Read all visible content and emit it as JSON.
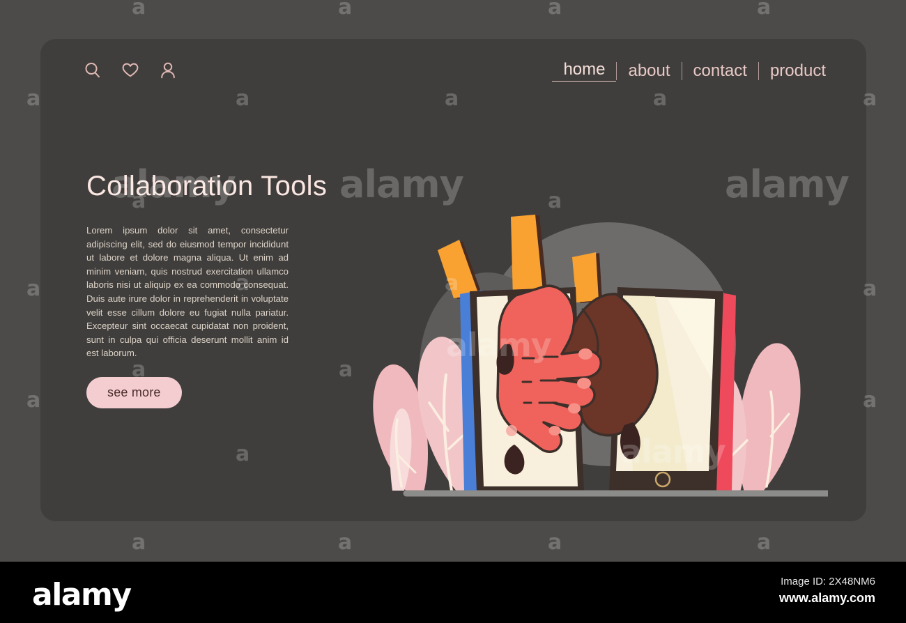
{
  "page": {
    "background_color": "#4c4b49",
    "card_color": "#403e3c"
  },
  "header": {
    "icons": [
      {
        "name": "search-icon",
        "label": "search"
      },
      {
        "name": "heart-icon",
        "label": "favorites"
      },
      {
        "name": "user-icon",
        "label": "account"
      }
    ],
    "nav": [
      {
        "label": "home",
        "active": true
      },
      {
        "label": "about",
        "active": false
      },
      {
        "label": "contact",
        "active": false
      },
      {
        "label": "product",
        "active": false
      }
    ],
    "separator": "|"
  },
  "hero": {
    "headline": "Collaboration Tools",
    "body": "Lorem ipsum dolor sit amet, consectetur adipiscing elit, sed do eiusmod tempor incididunt ut labore et dolore magna aliqua. Ut enim ad minim veniam, quis nostrud exercitation ullamco laboris nisi ut aliquip ex ea commodo consequat. Duis aute irure dolor in reprehenderit in voluptate velit esse cillum dolore eu fugiat nulla pariatur. Excepteur sint occaecat cupidatat non proident, sunt in culpa qui officia deserunt mollit anim id est laborum.",
    "cta_label": "see more"
  },
  "illustration": {
    "description": "two smartphones with hands shaking between their screens, orange rays above, pink leaves behind",
    "colors": {
      "phone_left_edge": "#4a7fd8",
      "phone_right_edge": "#ef4a5c",
      "phone_frame": "#3d2f2a",
      "screen_cream": "#f8f0dc",
      "hand_light": "#f0635c",
      "hand_dark": "#6b3528",
      "ray_orange": "#f9a232",
      "leaf_pink": "#f2c6c8",
      "blob_gray": "#6e6c6a",
      "ground_line": "#8c8c8a"
    }
  },
  "watermark": {
    "letter": "a",
    "word": "alamy"
  },
  "footer": {
    "logo": "alamy",
    "image_id": "Image ID: 2X48NM6",
    "url": "www.alamy.com"
  }
}
